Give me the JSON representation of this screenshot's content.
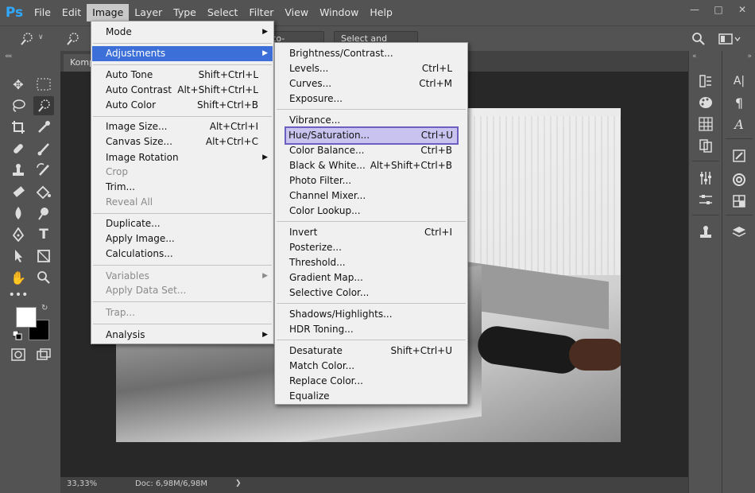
{
  "app": {
    "logo": "Ps"
  },
  "menubar": {
    "items": [
      "File",
      "Edit",
      "Image",
      "Layer",
      "Type",
      "Select",
      "Filter",
      "View",
      "Window",
      "Help"
    ]
  },
  "options_bar": {
    "auto_enhance": "to-Enhance",
    "select_and_mask": "Select and Mask..."
  },
  "document": {
    "tab_label": "Komp"
  },
  "status": {
    "zoom": "33,33%",
    "doc_size": "Doc: 6,98M/6,98M",
    "arrow": "❯"
  },
  "image_menu": {
    "items": [
      {
        "label": "Mode",
        "shortcut": "",
        "arrow": "▶",
        "disabled": false
      },
      {
        "label": "Adjustments",
        "shortcut": "",
        "arrow": "▶",
        "disabled": false
      },
      {
        "label": "Auto Tone",
        "shortcut": "Shift+Ctrl+L",
        "arrow": "",
        "disabled": false
      },
      {
        "label": "Auto Contrast",
        "shortcut": "Alt+Shift+Ctrl+L",
        "arrow": "",
        "disabled": false
      },
      {
        "label": "Auto Color",
        "shortcut": "Shift+Ctrl+B",
        "arrow": "",
        "disabled": false
      },
      {
        "label": "Image Size...",
        "shortcut": "Alt+Ctrl+I",
        "arrow": "",
        "disabled": false
      },
      {
        "label": "Canvas Size...",
        "shortcut": "Alt+Ctrl+C",
        "arrow": "",
        "disabled": false
      },
      {
        "label": "Image Rotation",
        "shortcut": "",
        "arrow": "▶",
        "disabled": false
      },
      {
        "label": "Crop",
        "shortcut": "",
        "arrow": "",
        "disabled": true
      },
      {
        "label": "Trim...",
        "shortcut": "",
        "arrow": "",
        "disabled": false
      },
      {
        "label": "Reveal All",
        "shortcut": "",
        "arrow": "",
        "disabled": true
      },
      {
        "label": "Duplicate...",
        "shortcut": "",
        "arrow": "",
        "disabled": false
      },
      {
        "label": "Apply Image...",
        "shortcut": "",
        "arrow": "",
        "disabled": false
      },
      {
        "label": "Calculations...",
        "shortcut": "",
        "arrow": "",
        "disabled": false
      },
      {
        "label": "Variables",
        "shortcut": "",
        "arrow": "▶",
        "disabled": true
      },
      {
        "label": "Apply Data Set...",
        "shortcut": "",
        "arrow": "",
        "disabled": true
      },
      {
        "label": "Trap...",
        "shortcut": "",
        "arrow": "",
        "disabled": true
      },
      {
        "label": "Analysis",
        "shortcut": "",
        "arrow": "▶",
        "disabled": false
      }
    ]
  },
  "adjustments_menu": {
    "items": [
      {
        "label": "Brightness/Contrast...",
        "shortcut": ""
      },
      {
        "label": "Levels...",
        "shortcut": "Ctrl+L"
      },
      {
        "label": "Curves...",
        "shortcut": "Ctrl+M"
      },
      {
        "label": "Exposure...",
        "shortcut": ""
      },
      {
        "label": "Vibrance...",
        "shortcut": ""
      },
      {
        "label": "Hue/Saturation...",
        "shortcut": "Ctrl+U"
      },
      {
        "label": "Color Balance...",
        "shortcut": "Ctrl+B"
      },
      {
        "label": "Black & White...",
        "shortcut": "Alt+Shift+Ctrl+B"
      },
      {
        "label": "Photo Filter...",
        "shortcut": ""
      },
      {
        "label": "Channel Mixer...",
        "shortcut": ""
      },
      {
        "label": "Color Lookup...",
        "shortcut": ""
      },
      {
        "label": "Invert",
        "shortcut": "Ctrl+I"
      },
      {
        "label": "Posterize...",
        "shortcut": ""
      },
      {
        "label": "Threshold...",
        "shortcut": ""
      },
      {
        "label": "Gradient Map...",
        "shortcut": ""
      },
      {
        "label": "Selective Color...",
        "shortcut": ""
      },
      {
        "label": "Shadows/Highlights...",
        "shortcut": ""
      },
      {
        "label": "HDR Toning...",
        "shortcut": ""
      },
      {
        "label": "Desaturate",
        "shortcut": "Shift+Ctrl+U"
      },
      {
        "label": "Match Color...",
        "shortcut": ""
      },
      {
        "label": "Replace Color...",
        "shortcut": ""
      },
      {
        "label": "Equalize",
        "shortcut": ""
      }
    ]
  },
  "right_panel_glyphs": {
    "character": "A|",
    "paragraph": "¶",
    "glyphs": "A"
  },
  "colors": {
    "ui_dark": "#535353",
    "canvas_bg": "#282828",
    "menu_bg": "#f0f0f0",
    "highlight": "#3d6fd8",
    "focus_box": "#6b5fbf",
    "ps_blue": "#31a8ff"
  }
}
